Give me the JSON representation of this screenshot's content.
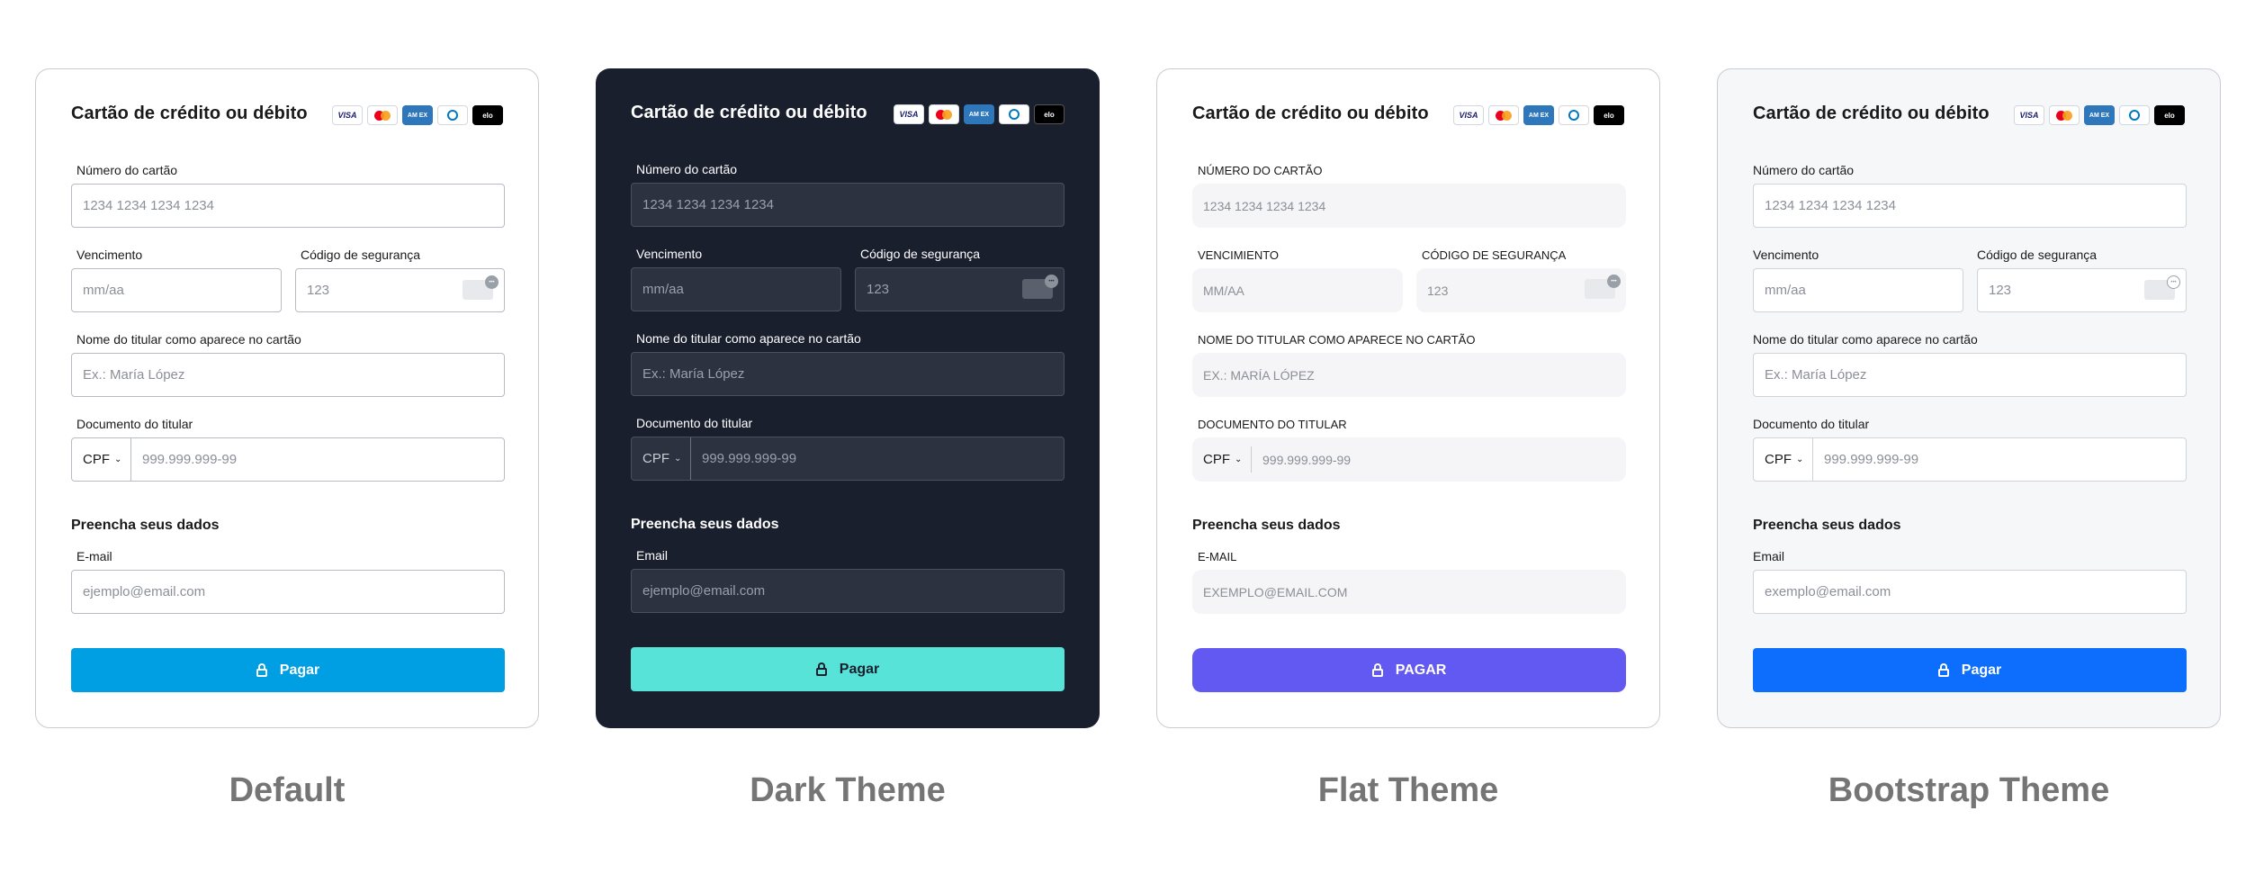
{
  "cards": [
    {
      "title": "Cartão de crédito ou débito",
      "card_number_label": "Número do cartão",
      "card_number_placeholder": "1234 1234 1234 1234",
      "expiry_label": "Vencimento",
      "expiry_placeholder": "mm/aa",
      "cvc_label": "Código de segurança",
      "cvc_placeholder": "123",
      "holder_label": "Nome do titular como aparece no cartão",
      "holder_placeholder": "Ex.: María López",
      "document_label": "Documento do titular",
      "document_type": "CPF",
      "document_placeholder": "999.999.999-99",
      "section_title": "Preencha seus dados",
      "email_label": "E-mail",
      "email_placeholder": "ejemplo@email.com",
      "pay_label": "Pagar",
      "caption": "Default",
      "accent": "#009ee3"
    },
    {
      "title": "Cartão de crédito ou débito",
      "card_number_label": "Número do cartão",
      "card_number_placeholder": "1234 1234 1234 1234",
      "expiry_label": "Vencimento",
      "expiry_placeholder": "mm/aa",
      "cvc_label": "Código de segurança",
      "cvc_placeholder": "123",
      "holder_label": "Nome do titular como aparece no cartão",
      "holder_placeholder": "Ex.: María López",
      "document_label": "Documento do titular",
      "document_type": "CPF",
      "document_placeholder": "999.999.999-99",
      "section_title": "Preencha seus dados",
      "email_label": "Email",
      "email_placeholder": "ejemplo@email.com",
      "pay_label": "Pagar",
      "caption": "Dark Theme",
      "accent": "#58e3d9"
    },
    {
      "title": "Cartão de crédito ou débito",
      "card_number_label": "NÚMERO DO CARTÃO",
      "card_number_placeholder": "1234 1234 1234 1234",
      "expiry_label": "VENCIMIENTO",
      "expiry_placeholder": "MM/AA",
      "cvc_label": "CÓDIGO DE SEGURANÇA",
      "cvc_placeholder": "123",
      "holder_label": "NOME DO TITULAR COMO APARECE NO CARTÃO",
      "holder_placeholder": "EX.: MARÍA LÓPEZ",
      "document_label": "DOCUMENTO DO TITULAR",
      "document_type": "CPF",
      "document_placeholder": "999.999.999-99",
      "section_title": "Preencha seus dados",
      "email_label": "E-MAIL",
      "email_placeholder": "EXEMPLO@EMAIL.COM",
      "pay_label": "PAGAR",
      "caption": "Flat Theme",
      "accent": "#6159f2"
    },
    {
      "title": "Cartão de crédito ou débito",
      "card_number_label": "Número do cartão",
      "card_number_placeholder": "1234 1234 1234 1234",
      "expiry_label": "Vencimento",
      "expiry_placeholder": "mm/aa",
      "cvc_label": "Código de segurança",
      "cvc_placeholder": "123",
      "holder_label": "Nome do titular como aparece no cartão",
      "holder_placeholder": "Ex.: María López",
      "document_label": "Documento do titular",
      "document_type": "CPF",
      "document_placeholder": "999.999.999-99",
      "section_title": "Preencha seus dados",
      "email_label": "Email",
      "email_placeholder": "exemplo@email.com",
      "pay_label": "Pagar",
      "caption": "Bootstrap Theme",
      "accent": "#0d6efd"
    }
  ],
  "card_brands": [
    {
      "name": "visa-logo",
      "text": "VISA"
    },
    {
      "name": "mastercard-logo",
      "text": ""
    },
    {
      "name": "amex-logo",
      "text": "AM EX"
    },
    {
      "name": "diners-logo",
      "text": ""
    },
    {
      "name": "elo-logo",
      "text": "elo"
    }
  ]
}
